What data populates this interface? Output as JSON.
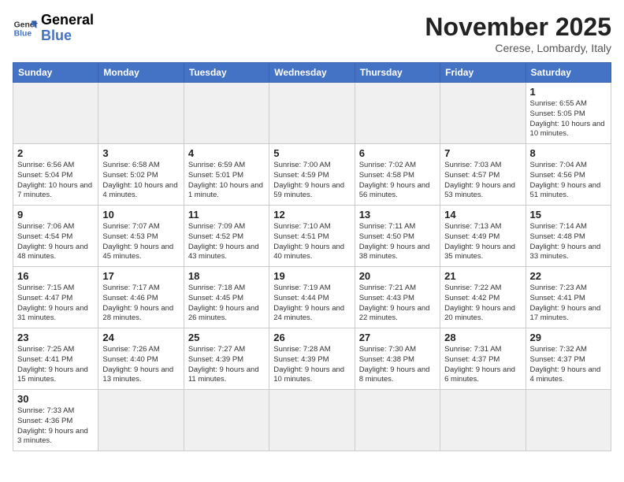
{
  "logo": {
    "text_general": "General",
    "text_blue": "Blue"
  },
  "header": {
    "title": "November 2025",
    "subtitle": "Cerese, Lombardy, Italy"
  },
  "weekdays": [
    "Sunday",
    "Monday",
    "Tuesday",
    "Wednesday",
    "Thursday",
    "Friday",
    "Saturday"
  ],
  "weeks": [
    [
      {
        "day": "",
        "info": ""
      },
      {
        "day": "",
        "info": ""
      },
      {
        "day": "",
        "info": ""
      },
      {
        "day": "",
        "info": ""
      },
      {
        "day": "",
        "info": ""
      },
      {
        "day": "",
        "info": ""
      },
      {
        "day": "1",
        "info": "Sunrise: 6:55 AM\nSunset: 5:05 PM\nDaylight: 10 hours and 10 minutes."
      }
    ],
    [
      {
        "day": "2",
        "info": "Sunrise: 6:56 AM\nSunset: 5:04 PM\nDaylight: 10 hours and 7 minutes."
      },
      {
        "day": "3",
        "info": "Sunrise: 6:58 AM\nSunset: 5:02 PM\nDaylight: 10 hours and 4 minutes."
      },
      {
        "day": "4",
        "info": "Sunrise: 6:59 AM\nSunset: 5:01 PM\nDaylight: 10 hours and 1 minute."
      },
      {
        "day": "5",
        "info": "Sunrise: 7:00 AM\nSunset: 4:59 PM\nDaylight: 9 hours and 59 minutes."
      },
      {
        "day": "6",
        "info": "Sunrise: 7:02 AM\nSunset: 4:58 PM\nDaylight: 9 hours and 56 minutes."
      },
      {
        "day": "7",
        "info": "Sunrise: 7:03 AM\nSunset: 4:57 PM\nDaylight: 9 hours and 53 minutes."
      },
      {
        "day": "8",
        "info": "Sunrise: 7:04 AM\nSunset: 4:56 PM\nDaylight: 9 hours and 51 minutes."
      }
    ],
    [
      {
        "day": "9",
        "info": "Sunrise: 7:06 AM\nSunset: 4:54 PM\nDaylight: 9 hours and 48 minutes."
      },
      {
        "day": "10",
        "info": "Sunrise: 7:07 AM\nSunset: 4:53 PM\nDaylight: 9 hours and 45 minutes."
      },
      {
        "day": "11",
        "info": "Sunrise: 7:09 AM\nSunset: 4:52 PM\nDaylight: 9 hours and 43 minutes."
      },
      {
        "day": "12",
        "info": "Sunrise: 7:10 AM\nSunset: 4:51 PM\nDaylight: 9 hours and 40 minutes."
      },
      {
        "day": "13",
        "info": "Sunrise: 7:11 AM\nSunset: 4:50 PM\nDaylight: 9 hours and 38 minutes."
      },
      {
        "day": "14",
        "info": "Sunrise: 7:13 AM\nSunset: 4:49 PM\nDaylight: 9 hours and 35 minutes."
      },
      {
        "day": "15",
        "info": "Sunrise: 7:14 AM\nSunset: 4:48 PM\nDaylight: 9 hours and 33 minutes."
      }
    ],
    [
      {
        "day": "16",
        "info": "Sunrise: 7:15 AM\nSunset: 4:47 PM\nDaylight: 9 hours and 31 minutes."
      },
      {
        "day": "17",
        "info": "Sunrise: 7:17 AM\nSunset: 4:46 PM\nDaylight: 9 hours and 28 minutes."
      },
      {
        "day": "18",
        "info": "Sunrise: 7:18 AM\nSunset: 4:45 PM\nDaylight: 9 hours and 26 minutes."
      },
      {
        "day": "19",
        "info": "Sunrise: 7:19 AM\nSunset: 4:44 PM\nDaylight: 9 hours and 24 minutes."
      },
      {
        "day": "20",
        "info": "Sunrise: 7:21 AM\nSunset: 4:43 PM\nDaylight: 9 hours and 22 minutes."
      },
      {
        "day": "21",
        "info": "Sunrise: 7:22 AM\nSunset: 4:42 PM\nDaylight: 9 hours and 20 minutes."
      },
      {
        "day": "22",
        "info": "Sunrise: 7:23 AM\nSunset: 4:41 PM\nDaylight: 9 hours and 17 minutes."
      }
    ],
    [
      {
        "day": "23",
        "info": "Sunrise: 7:25 AM\nSunset: 4:41 PM\nDaylight: 9 hours and 15 minutes."
      },
      {
        "day": "24",
        "info": "Sunrise: 7:26 AM\nSunset: 4:40 PM\nDaylight: 9 hours and 13 minutes."
      },
      {
        "day": "25",
        "info": "Sunrise: 7:27 AM\nSunset: 4:39 PM\nDaylight: 9 hours and 11 minutes."
      },
      {
        "day": "26",
        "info": "Sunrise: 7:28 AM\nSunset: 4:39 PM\nDaylight: 9 hours and 10 minutes."
      },
      {
        "day": "27",
        "info": "Sunrise: 7:30 AM\nSunset: 4:38 PM\nDaylight: 9 hours and 8 minutes."
      },
      {
        "day": "28",
        "info": "Sunrise: 7:31 AM\nSunset: 4:37 PM\nDaylight: 9 hours and 6 minutes."
      },
      {
        "day": "29",
        "info": "Sunrise: 7:32 AM\nSunset: 4:37 PM\nDaylight: 9 hours and 4 minutes."
      }
    ],
    [
      {
        "day": "30",
        "info": "Sunrise: 7:33 AM\nSunset: 4:36 PM\nDaylight: 9 hours and 3 minutes."
      },
      {
        "day": "",
        "info": ""
      },
      {
        "day": "",
        "info": ""
      },
      {
        "day": "",
        "info": ""
      },
      {
        "day": "",
        "info": ""
      },
      {
        "day": "",
        "info": ""
      },
      {
        "day": "",
        "info": ""
      }
    ]
  ]
}
